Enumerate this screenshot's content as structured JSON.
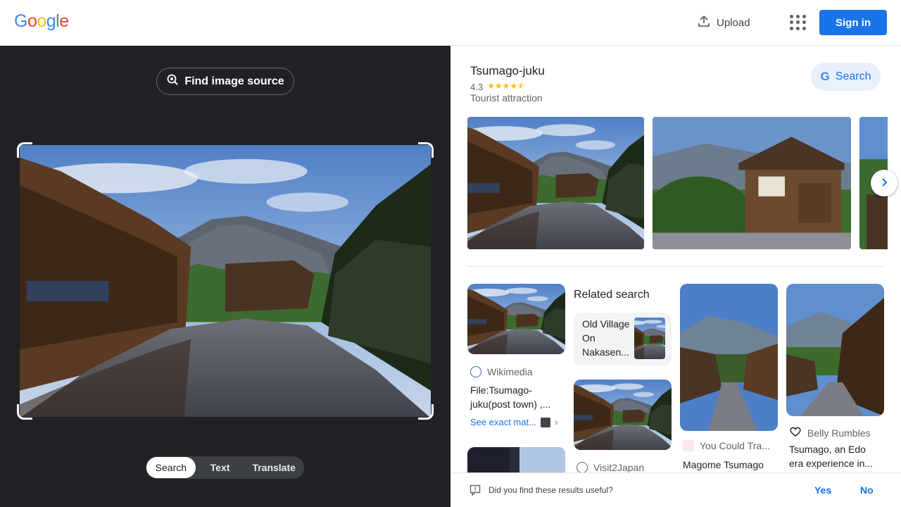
{
  "header": {
    "logo_letters": [
      {
        "ch": "G",
        "color": "#4285f4"
      },
      {
        "ch": "o",
        "color": "#ea4335"
      },
      {
        "ch": "o",
        "color": "#fbbc05"
      },
      {
        "ch": "g",
        "color": "#4285f4"
      },
      {
        "ch": "l",
        "color": "#34a853"
      },
      {
        "ch": "e",
        "color": "#ea4335"
      }
    ],
    "upload_label": "Upload",
    "apps_icon": "apps-grid-icon",
    "signin_label": "Sign in"
  },
  "lens": {
    "find_source_label": "Find image source",
    "modes": [
      "Search",
      "Text",
      "Translate"
    ],
    "active_mode": "Search"
  },
  "entity": {
    "title": "Tsumago-juku",
    "rating": "4.3",
    "stars": "★★★★⯪",
    "type": "Tourist attraction",
    "search_label": "Search"
  },
  "results": {
    "related_heading": "Related search",
    "related_query": "Old Village On Nakasen...",
    "cards": [
      {
        "source": "Wikimedia",
        "title": "File:Tsumago-juku(post town) ,...",
        "exact_label": "See exact mat..."
      },
      {
        "source": "Visit2Japan"
      },
      {
        "source": "You Could Tra...",
        "title": "Magome Tsumago"
      },
      {
        "source": "Belly Rumbles",
        "title": "Tsumago, an Edo era experience in..."
      }
    ]
  },
  "feedback": {
    "question": "Did you find these results useful?",
    "yes": "Yes",
    "no": "No"
  },
  "colors": {
    "accent": "#1a73e8",
    "dark_panel": "#202124"
  }
}
